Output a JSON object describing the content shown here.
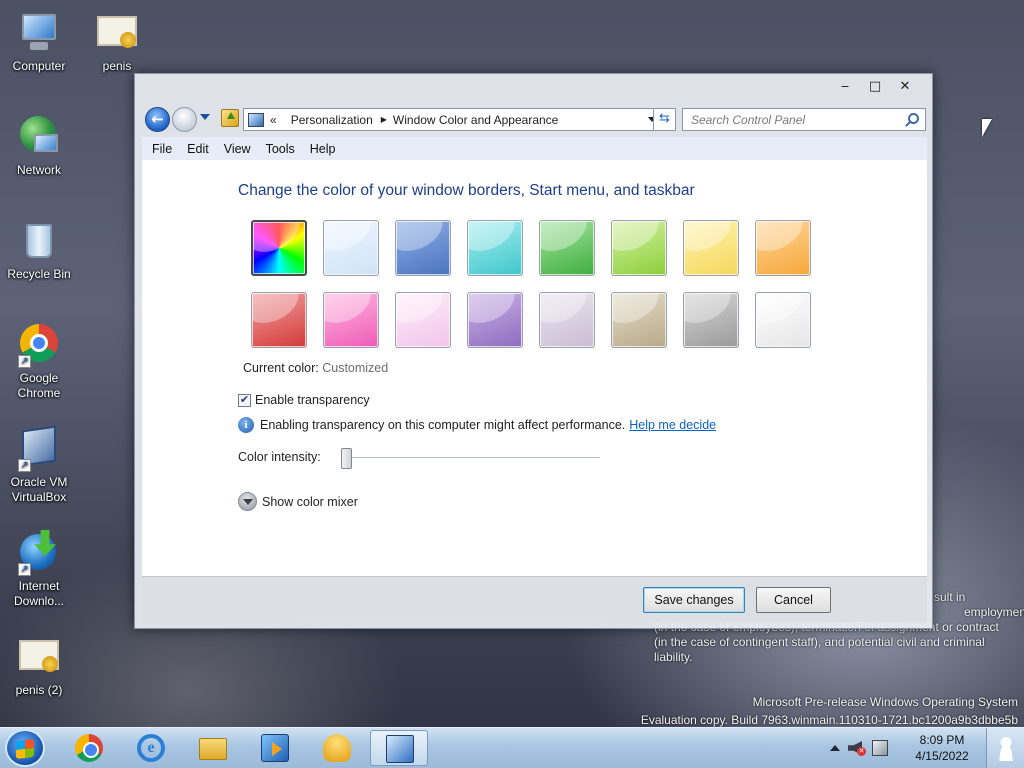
{
  "desktop": {
    "icons": [
      {
        "label": "Computer",
        "icon": "computer-icon"
      },
      {
        "label": "penis",
        "icon": "certificate-icon"
      },
      {
        "label": "Network",
        "icon": "network-icon"
      },
      {
        "label": "Recycle Bin",
        "icon": "recycle-bin-icon"
      },
      {
        "label": "Google Chrome",
        "icon": "chrome-icon"
      },
      {
        "label": "Oracle VM VirtualBox",
        "icon": "virtualbox-icon"
      },
      {
        "label": "Internet Downlo...",
        "icon": "internet-download-manager-icon"
      },
      {
        "label": "penis (2)",
        "icon": "certificate-icon"
      }
    ],
    "legal_lines": [
      "sult in",
      "employment",
      "(in the case of employees), termination of assignment or contract",
      "(in the case of contingent staff), and potential civil and criminal",
      "liability."
    ],
    "watermark_line1": "Microsoft Pre-release Windows Operating System",
    "watermark_line2": "Evaluation copy. Build 7963.winmain.110310-1721.bc1200a9b3dbbe5b"
  },
  "window": {
    "title_buttons": {
      "minimize": "‒",
      "maximize": "□",
      "close": "✕"
    },
    "address": {
      "overflow": "«",
      "crumb1": "Personalization",
      "crumb_sep": "▶",
      "crumb2": "Window Color and Appearance"
    },
    "search": {
      "placeholder": "Search Control Panel"
    },
    "menu": [
      "File",
      "Edit",
      "View",
      "Tools",
      "Help"
    ],
    "heading": "Change the color of your window borders, Start menu, and taskbar",
    "swatches": [
      {
        "name": "rainbow",
        "colors": [
          "#ff0000",
          "#00ff00",
          "#0000ff"
        ],
        "selected": true
      },
      {
        "name": "sky",
        "colors": [
          "#eef6ff",
          "#cfe3f7"
        ]
      },
      {
        "name": "twilight",
        "colors": [
          "#8fb0e6",
          "#4a74c0"
        ]
      },
      {
        "name": "sea",
        "colors": [
          "#a8f0f0",
          "#3fc6cc"
        ]
      },
      {
        "name": "leaf",
        "colors": [
          "#a6e6a0",
          "#3fae3e"
        ]
      },
      {
        "name": "lime",
        "colors": [
          "#d6f2a4",
          "#8ccf3a"
        ]
      },
      {
        "name": "lemon",
        "colors": [
          "#fff4b5",
          "#f5d85a"
        ]
      },
      {
        "name": "tangerine",
        "colors": [
          "#ffd79a",
          "#f7a73a"
        ]
      },
      {
        "name": "ruby",
        "colors": [
          "#f2a0a0",
          "#d43a3a"
        ]
      },
      {
        "name": "fuchsia",
        "colors": [
          "#ffb8e2",
          "#ef5bb6"
        ]
      },
      {
        "name": "blush",
        "colors": [
          "#fff0fb",
          "#f2c4ea"
        ]
      },
      {
        "name": "violet",
        "colors": [
          "#cbb3e6",
          "#8e6cc0"
        ]
      },
      {
        "name": "lavender",
        "colors": [
          "#ece6f0",
          "#cbbcd4"
        ]
      },
      {
        "name": "taupe",
        "colors": [
          "#e6dfcd",
          "#b8a987"
        ]
      },
      {
        "name": "chocolate",
        "colors": [
          "#d7d7d7",
          "#9a9a9a"
        ]
      },
      {
        "name": "frost",
        "colors": [
          "#ffffff",
          "#e6e6e6"
        ]
      }
    ],
    "current_color_label": "Current color:",
    "current_color_value": "Customized",
    "checkbox_checked": "✔",
    "transparency_label": "Enable transparency",
    "info_icon_glyph": "i",
    "info_text": "Enabling transparency on this computer might affect performance.",
    "help_link": "Help me decide",
    "intensity_label": "Color intensity:",
    "intensity_value": 0,
    "mixer_label": "Show color mixer",
    "save_label": "Save changes",
    "cancel_label": "Cancel"
  },
  "taskbar": {
    "items": [
      "chrome-icon",
      "internet-explorer-icon",
      "file-explorer-icon",
      "media-player-icon",
      "shell-icon",
      "control-panel-icon"
    ],
    "ie_glyph": "e",
    "time": "8:09 PM",
    "date": "4/15/2022"
  }
}
